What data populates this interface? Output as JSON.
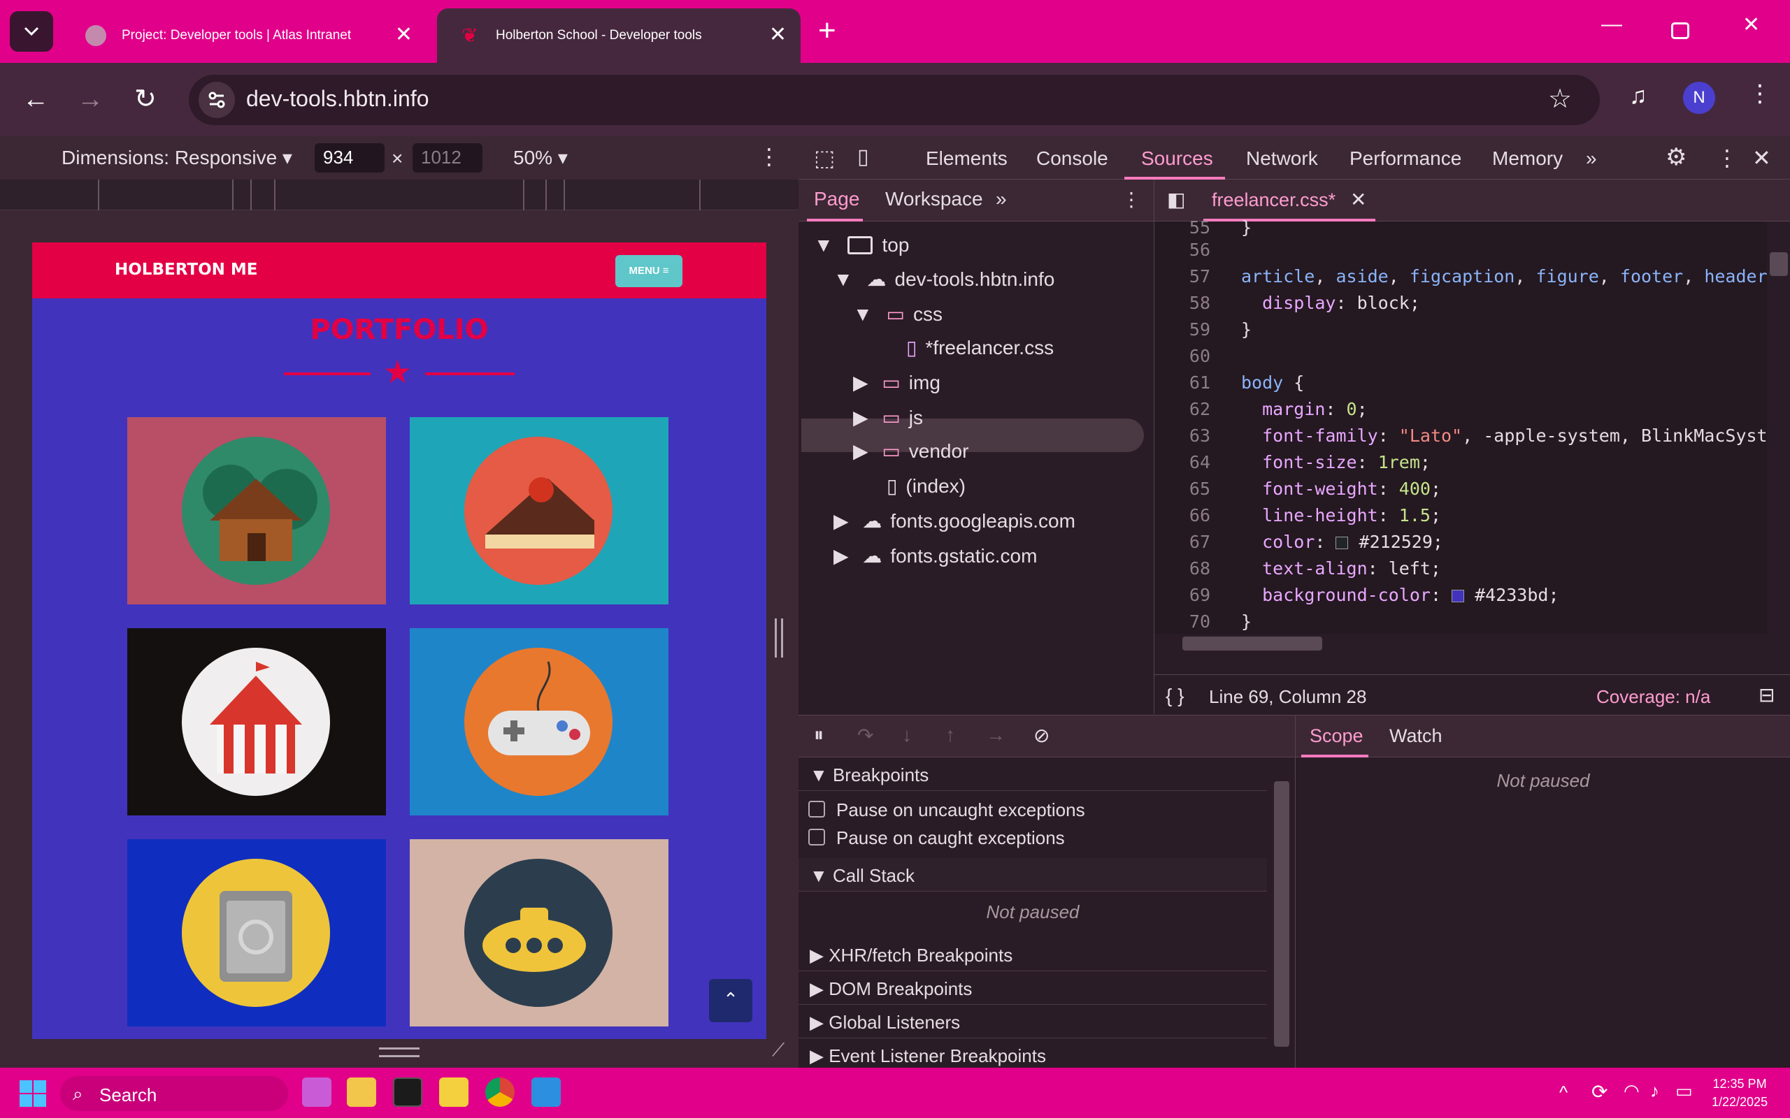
{
  "browser": {
    "tabs": [
      {
        "title": "Project: Developer tools | Atlas Intranet"
      },
      {
        "title": "Holberton School - Developer tools"
      }
    ],
    "url": "dev-tools.hbtn.info",
    "profile_initial": "N"
  },
  "device_toolbar": {
    "dimensions_label": "Dimensions: Responsive",
    "width": "934",
    "height": "1012",
    "times": "×",
    "zoom": "50%"
  },
  "page": {
    "brand": "HOLBERTON ME",
    "menu_label": "MENU ≡",
    "title": "PORTFOLIO",
    "back_to_top": "⌃"
  },
  "devtools": {
    "tabs": [
      "Elements",
      "Console",
      "Sources",
      "Network",
      "Performance",
      "Memory"
    ],
    "active_tab": "Sources",
    "navigator_tabs": [
      "Page",
      "Workspace"
    ],
    "tree": {
      "top": "top",
      "domain": "dev-tools.hbtn.info",
      "css": "css",
      "file": "*freelancer.css",
      "img": "img",
      "js": "js",
      "vendor": "vendor",
      "index": "(index)",
      "fonts1": "fonts.googleapis.com",
      "fonts2": "fonts.gstatic.com"
    },
    "editor_tab": "freelancer.css*",
    "status": {
      "position": "Line 69, Column 28",
      "coverage": "Coverage: n/a"
    },
    "debugger": {
      "breakpoints": "Breakpoints",
      "pause_uncaught": "Pause on uncaught exceptions",
      "pause_caught": "Pause on caught exceptions",
      "call_stack": "Call Stack",
      "not_paused": "Not paused",
      "xhr": "XHR/fetch Breakpoints",
      "dom": "DOM Breakpoints",
      "global": "Global Listeners",
      "event": "Event Listener Breakpoints"
    },
    "scope_tabs": [
      "Scope",
      "Watch"
    ],
    "scope_status": "Not paused"
  },
  "taskbar": {
    "search": "Search",
    "time": "12:35 PM",
    "date": "1/22/2025"
  },
  "colors": {
    "accent": "#e1008a",
    "page_bg": "#4233bd",
    "page_nav": "#e30045"
  }
}
